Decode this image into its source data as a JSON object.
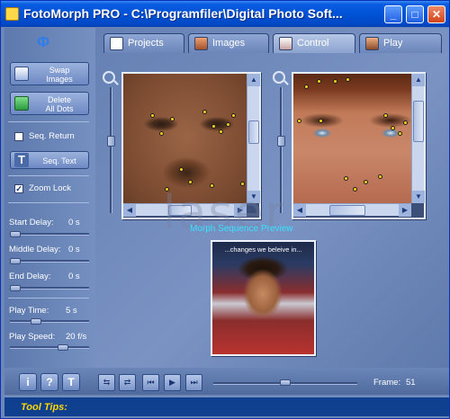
{
  "window": {
    "title": "FotoMorph PRO - C:\\Programfiler\\Digital Photo Soft...",
    "minimize_glyph": "_",
    "maximize_glyph": "□",
    "close_glyph": "✕"
  },
  "tabs": [
    {
      "label": "Projects",
      "icon": "grid-icon",
      "active": false
    },
    {
      "label": "Images",
      "icon": "image-icon",
      "active": false
    },
    {
      "label": "Control",
      "icon": "control-icon",
      "active": true
    },
    {
      "label": "Play",
      "icon": "play-icon",
      "active": false
    }
  ],
  "left_panel": {
    "logo_glyph": "Φ",
    "swap_images": "Swap\nImages",
    "delete_all_dots": "Delete\nAll Dots",
    "seq_return": {
      "label": "Seq. Return",
      "checked": false
    },
    "seq_text": "Seq. Text",
    "zoom_lock": {
      "label": "Zoom Lock",
      "checked": true,
      "check_glyph": "✓"
    },
    "start_delay": {
      "label": "Start Delay:",
      "value": "0 s",
      "level": 0.0
    },
    "middle_delay": {
      "label": "Middle Delay:",
      "value": "0 s",
      "level": 0.0
    },
    "end_delay": {
      "label": "End Delay:",
      "value": "0 s",
      "level": 0.0
    },
    "play_time": {
      "label": "Play Time:",
      "value": "5 s",
      "level": 0.3
    },
    "play_speed": {
      "label": "Play Speed:",
      "value": "20 f/s",
      "level": 0.7
    }
  },
  "main": {
    "preview_title": "Morph Sequence Preview",
    "preview_caption": "...changes we beleive in...",
    "watermark": "laser"
  },
  "bottom": {
    "info_glyph": "i",
    "help_glyph": "?",
    "text_glyph": "T",
    "frame_label": "Frame:",
    "frame_value": "51",
    "frame_level": 0.5
  },
  "tooltips": {
    "label": "Tool Tips:"
  },
  "colors": {
    "accent": "#0a5ce0",
    "dot": "#ffd21a",
    "preview_title": "#39e2ff",
    "tooltip": "#ffd800"
  }
}
